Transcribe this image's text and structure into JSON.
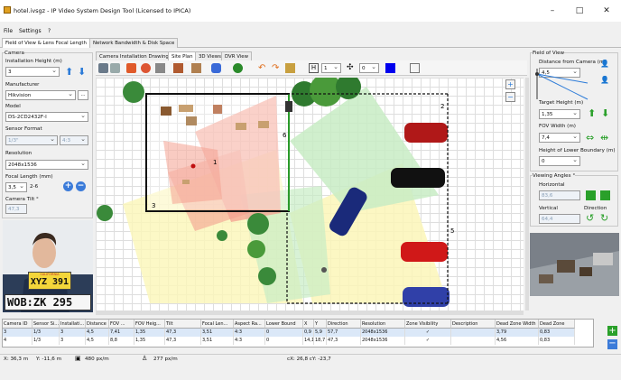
{
  "window": {
    "title": "hotel.ivsgz - IP Video System Design Tool (Licensed to IPICA)",
    "minimize": "–",
    "maximize": "□",
    "close": "✕"
  },
  "menu": {
    "file": "File",
    "settings": "Settings",
    "help": "?"
  },
  "main_tabs": [
    "Field of View & Lens Focal Length",
    "Network Bandwidth & Disk Space"
  ],
  "view_tabs": [
    "Camera Installation Drawing",
    "Site Plan",
    "3D Views",
    "DVR View"
  ],
  "left": {
    "camera_group": "Camera",
    "install_height_label": "Installation Height (m)",
    "install_height": "3",
    "manufacturer_label": "Manufacturer",
    "manufacturer": "Hikvision",
    "browse": "...",
    "model_label": "Model",
    "model": "DS-2CD2432F-I",
    "sensor_label": "Sensor Format",
    "sensor": "1/3\"",
    "aspect": "4:3",
    "resolution_label": "Resolution",
    "resolution": "2048x1536",
    "focal_label": "Focal Length (mm)",
    "focal": "3,5",
    "focal_range": "2-6",
    "tilt_label": "Camera Tilt °",
    "tilt": "47,3",
    "plate1": "XYZ 391",
    "plate1_top": "CALIFORNIA",
    "plate2": "WOB:ZK 295"
  },
  "right": {
    "fov_group": "Field of View",
    "distance_label": "Distance from Camera (m)",
    "distance": "4,5",
    "target_height_label": "Target Height (m)",
    "target_height": "1,35",
    "fov_width_label": "FOV Width (m)",
    "fov_width": "7,4",
    "lower_boundary_label": "Height of Lower Boundary (m)",
    "lower_boundary": "0",
    "viewing_group": "Viewing Angles °",
    "horizontal_label": "Horizontal",
    "horizontal": "83,6",
    "vertical_label": "Vertical",
    "vertical": "64,4",
    "direction_label": "Direction"
  },
  "toolbar": {
    "width_val": "1",
    "height_val": "0",
    "h_btn": "H"
  },
  "canvas": {
    "label2": "2",
    "label3": "3",
    "label5": "5",
    "label6": "6",
    "label1": "1"
  },
  "table": {
    "headers": [
      "Camera ID",
      "Sensor Si...",
      "Installati...",
      "Distance",
      "FOV ...",
      "FOV Heig...",
      "Tilt",
      "Focal Len...",
      "Aspect Ra...",
      "Lower Bound",
      "X",
      "Y",
      "Direction",
      "Resolution",
      "Zone Visibility",
      "Description",
      "Dead Zone Width",
      "Dead Zone"
    ],
    "rows": [
      [
        "3",
        "1/3",
        "3",
        "4,5",
        "7,41",
        "1,35",
        "47,3",
        "3,51",
        "4:3",
        "0",
        "0,9",
        "5,9",
        "57,7",
        "2048x1536",
        "✓",
        "",
        "3,79",
        "0,83"
      ],
      [
        "4",
        "1/3",
        "3",
        "4,5",
        "8,8",
        "1,35",
        "47,3",
        "3,51",
        "4:3",
        "0",
        "14,1",
        "18,7",
        "47,3",
        "2048x1536",
        "✓",
        "",
        "4,56",
        "0,83"
      ]
    ]
  },
  "status": {
    "x": "X: 36,3 m",
    "y": "Y: -11,6 m",
    "ppm1": "480 px/m",
    "ppm2": "277 px/m",
    "coords": "cX: 26,8 cY: -23,7"
  },
  "colors": {
    "accent": "#2a7ad8",
    "zone_red": "#f4a090",
    "zone_green": "#c8ecc4",
    "zone_yellow": "#fbf6b8"
  }
}
